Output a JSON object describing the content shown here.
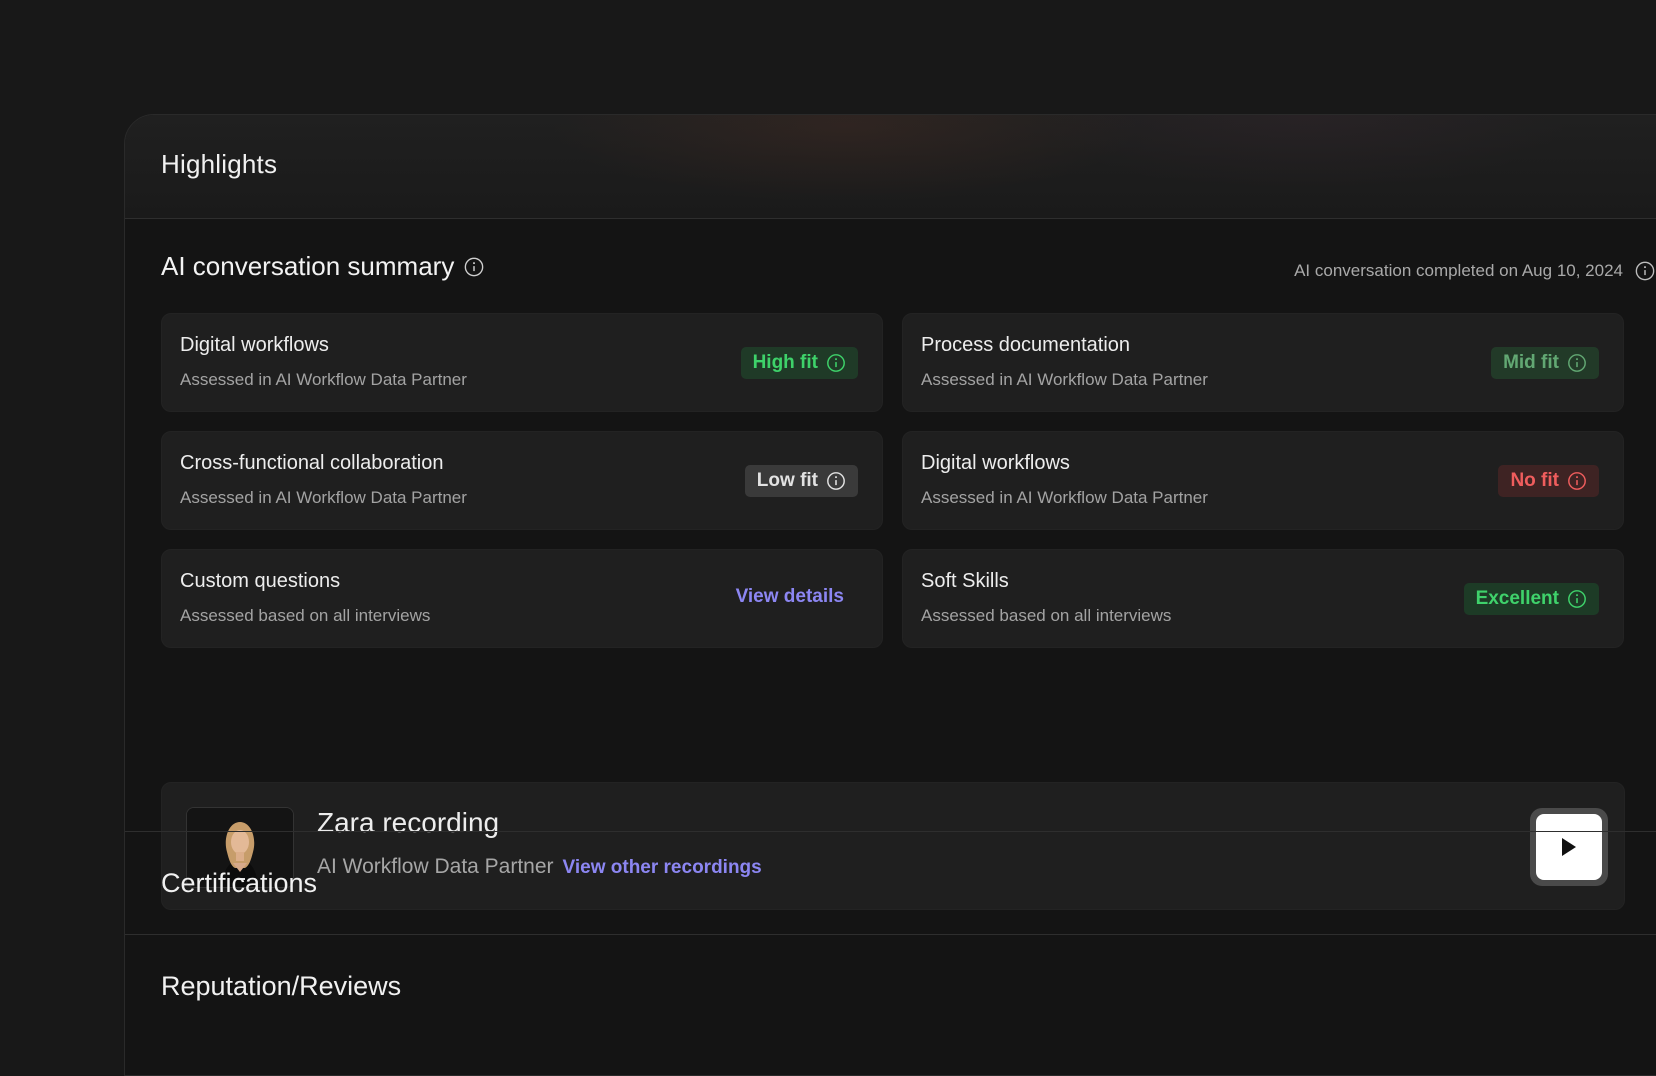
{
  "highlights": {
    "title": "Highlights"
  },
  "summary": {
    "title": "AI conversation summary",
    "completed_text": "AI conversation completed on Aug 10, 2024"
  },
  "cards": [
    {
      "title": "Digital workflows",
      "subtitle": "Assessed in AI Workflow Data Partner",
      "badge": "High fit",
      "badge_type": "high"
    },
    {
      "title": "Process documentation",
      "subtitle": "Assessed in AI Workflow Data Partner",
      "badge": "Mid fit",
      "badge_type": "mid"
    },
    {
      "title": "Cross-functional collaboration",
      "subtitle": "Assessed in AI Workflow Data Partner",
      "badge": "Low fit",
      "badge_type": "low"
    },
    {
      "title": "Digital workflows",
      "subtitle": "Assessed in AI Workflow Data Partner",
      "badge": "No fit",
      "badge_type": "no"
    },
    {
      "title": "Custom questions",
      "subtitle": "Assessed based on all interviews",
      "link": "View details"
    },
    {
      "title": "Soft Skills",
      "subtitle": "Assessed based on all interviews",
      "badge": "Excellent",
      "badge_type": "excellent"
    }
  ],
  "recording": {
    "title": "Zara recording",
    "role": "AI Workflow Data Partner",
    "link": "View other recordings"
  },
  "sections": {
    "certifications": "Certifications",
    "reviews": "Reputation/Reviews"
  },
  "colors": {
    "link": "#8c86f2",
    "high": "#3ed26a",
    "mid": "#62a873",
    "low": "#e2e2e2",
    "no": "#ef5d5d",
    "excellent": "#3fd26b"
  }
}
